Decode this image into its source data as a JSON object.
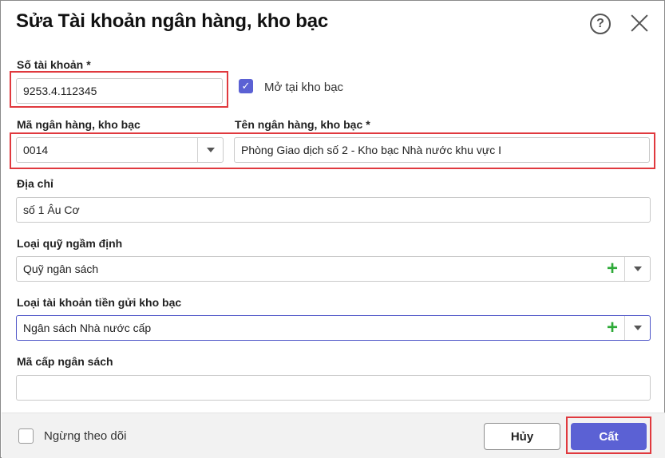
{
  "dialog": {
    "title": "Sửa Tài khoản ngân hàng, kho bạc",
    "help_icon": "question-circle-icon",
    "close_icon": "close-icon"
  },
  "account_number": {
    "label": "Số tài khoản",
    "required_mark": "*",
    "value": "9253.4.112345"
  },
  "treasury_checkbox": {
    "label": "Mở tại kho bạc",
    "checked": true
  },
  "bank_code": {
    "label": "Mã ngân hàng, kho bạc",
    "value": "0014"
  },
  "bank_name": {
    "label": "Tên ngân hàng, kho bạc",
    "required_mark": "*",
    "value": "Phòng Giao dịch số 2 - Kho bạc Nhà nước khu vực I"
  },
  "address": {
    "label": "Địa chỉ",
    "value": "số 1 Âu Cơ"
  },
  "default_fund": {
    "label": "Loại quỹ ngầm định",
    "value": "Quỹ ngân sách"
  },
  "deposit_type": {
    "label": "Loại tài khoản tiền gửi kho bạc",
    "value": "Ngân sách Nhà nước cấp"
  },
  "budget_level": {
    "label": "Mã cấp ngân sách",
    "value": ""
  },
  "footer": {
    "stop_tracking_label": "Ngừng theo dõi",
    "stop_tracking_checked": false,
    "cancel_label": "Hủy",
    "save_label": "Cất"
  },
  "colors": {
    "accent": "#5b61d4",
    "highlight": "#e0393e",
    "add_green": "#2eaa38"
  }
}
